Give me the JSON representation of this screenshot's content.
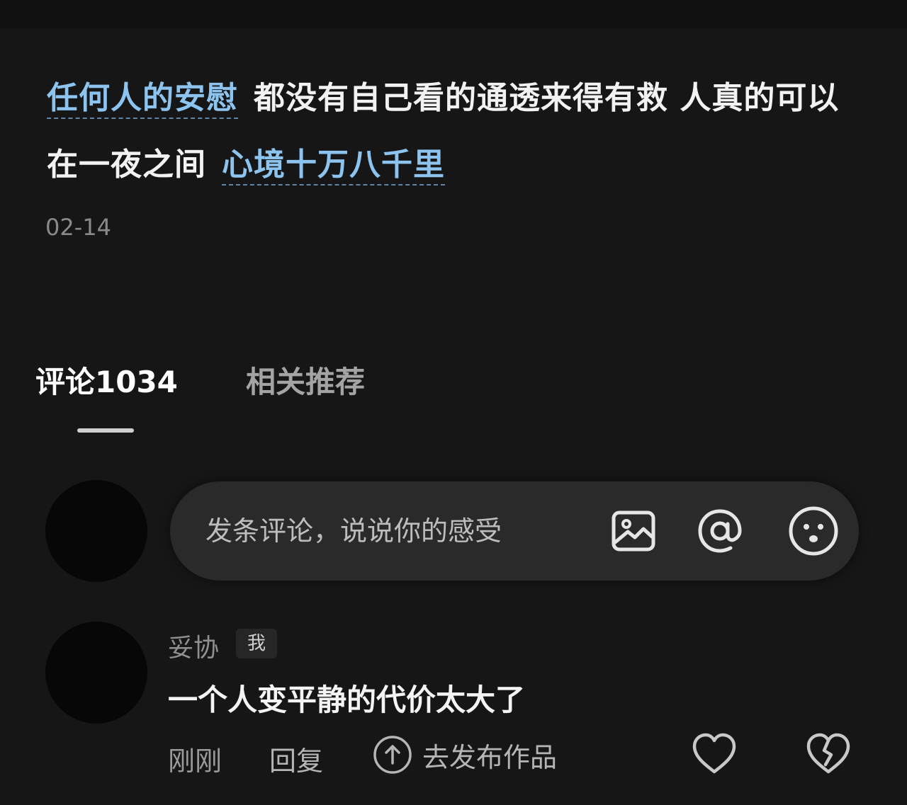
{
  "post": {
    "segments": [
      {
        "text": "任何人的安慰",
        "topic": true
      },
      {
        "text": "都没有自己看的通透来得有救 人真的可以在一夜之间",
        "topic": false
      },
      {
        "text": "心境十万八千里",
        "topic": true
      }
    ],
    "date": "02-14"
  },
  "tabs": [
    {
      "label": "评论1034",
      "active": true
    },
    {
      "label": "相关推荐",
      "active": false
    }
  ],
  "comment_box": {
    "placeholder": "发条评论，说说你的感受",
    "icons": [
      "image-icon",
      "at-icon",
      "emoji-icon"
    ]
  },
  "comment": {
    "username": "妥协",
    "badge": "我",
    "text": "一个人变平静的代价太大了",
    "time": "刚刚",
    "reply_label": "回复",
    "publish_label": "去发布作品",
    "icons": [
      "arrow-up-circle-icon",
      "heart-icon",
      "broken-heart-icon"
    ]
  },
  "colors": {
    "background": "#161616",
    "topic_link": "#8cc4ef",
    "primary_text": "#f2f2f2",
    "secondary_text": "#8a8a8a"
  }
}
